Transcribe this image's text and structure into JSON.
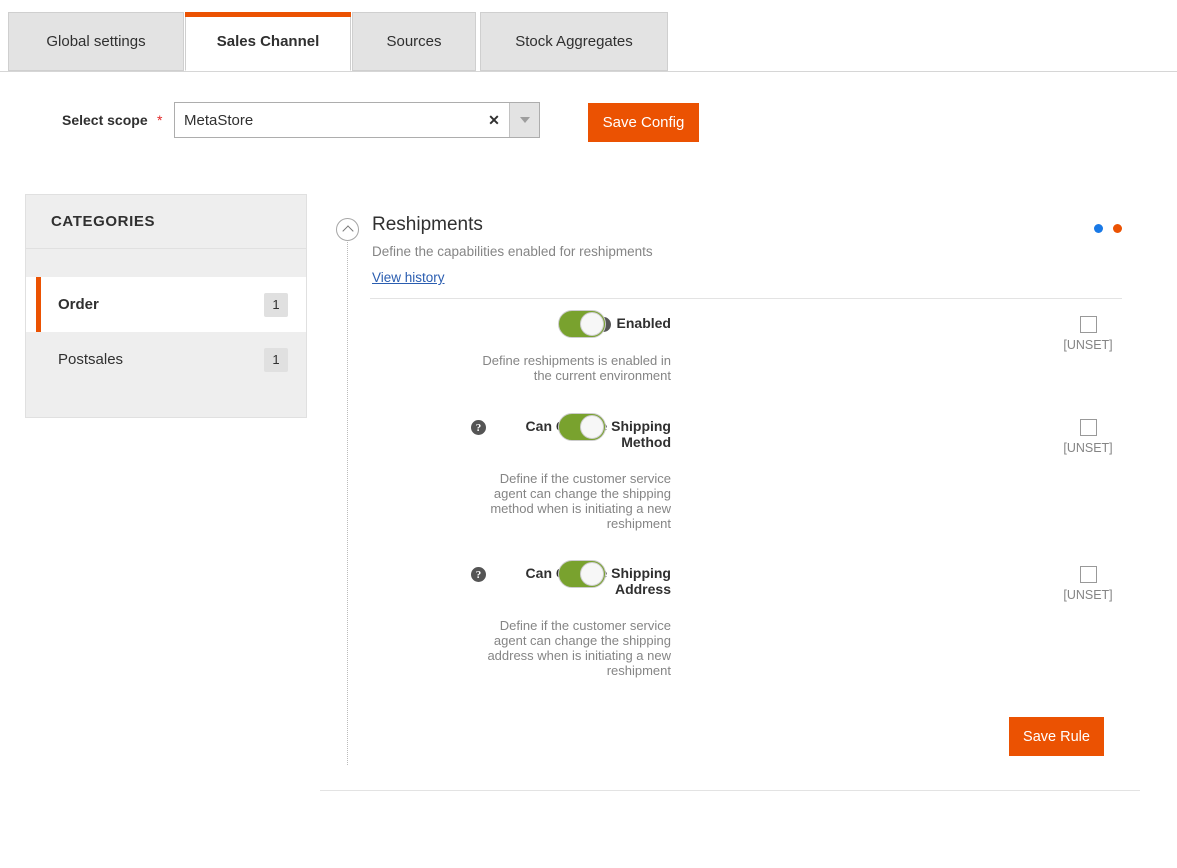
{
  "tabs": [
    {
      "label": "Global settings",
      "active": false
    },
    {
      "label": "Sales Channel",
      "active": true
    },
    {
      "label": "Sources",
      "active": false
    },
    {
      "label": "Stock Aggregates",
      "active": false
    }
  ],
  "scope": {
    "label": "Select scope",
    "required_marker": "*",
    "value": "MetaStore",
    "clear_glyph": "✕",
    "save_button": "Save Config"
  },
  "categories": {
    "heading": "CATEGORIES",
    "items": [
      {
        "label": "Order",
        "count": "1",
        "active": true
      },
      {
        "label": "Postsales",
        "count": "1",
        "active": false
      }
    ]
  },
  "panel": {
    "title": "Reshipments",
    "description": "Define the capabilities enabled for reshipments",
    "history_link": "View history",
    "dots": [
      {
        "color": "#1979e6"
      },
      {
        "color": "#eb5202"
      }
    ],
    "settings": [
      {
        "label": "Enabled",
        "help_glyph": "?",
        "description": "Define reshipments is enabled in the current environment",
        "toggle_on": true,
        "toggle_color": "#79a22e",
        "unset_label": "[UNSET]",
        "unset_checked": false
      },
      {
        "label": "Can Change Shipping Method",
        "help_glyph": "?",
        "description": "Define if the customer service agent can change the shipping method when is initiating a new reshipment",
        "toggle_on": true,
        "toggle_color": "#79a22e",
        "unset_label": "[UNSET]",
        "unset_checked": false
      },
      {
        "label": "Can Change Shipping Address",
        "help_glyph": "?",
        "description": "Define if the customer service agent can change the shipping address when is initiating a new reshipment",
        "toggle_on": true,
        "toggle_color": "#79a22e",
        "unset_label": "[UNSET]",
        "unset_checked": false
      }
    ],
    "save_rule_button": "Save Rule"
  }
}
